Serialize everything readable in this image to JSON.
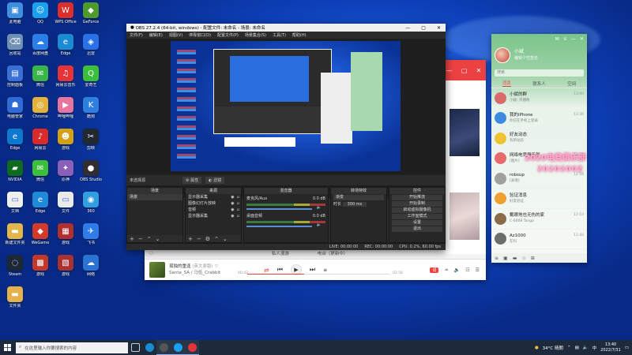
{
  "desktop": {
    "icons": [
      {
        "label": "此电脑",
        "color": "#3f8fe0",
        "glyph": "▣"
      },
      {
        "label": "QQ",
        "color": "#1aa0f0",
        "glyph": "☺"
      },
      {
        "label": "WPS Office",
        "color": "#d9302f",
        "glyph": "W"
      },
      {
        "label": "GeForce",
        "color": "#4e9a2c",
        "glyph": "◆"
      },
      {
        "label": "回收站",
        "color": "#6f8fb5",
        "glyph": "⌫"
      },
      {
        "label": "百度网盘",
        "color": "#2a7fe6",
        "glyph": "☁"
      },
      {
        "label": "Edge",
        "color": "#1a8ad2",
        "glyph": "e"
      },
      {
        "label": "迅雷",
        "color": "#2a70e6",
        "glyph": "◈"
      },
      {
        "label": "控制面板",
        "color": "#3a6fd6",
        "glyph": "▤"
      },
      {
        "label": "微信",
        "color": "#39b54a",
        "glyph": "✉"
      },
      {
        "label": "网易云音乐",
        "color": "#e5333a",
        "glyph": "♫"
      },
      {
        "label": "爱奇艺",
        "color": "#3cbf3a",
        "glyph": "Q"
      },
      {
        "label": "电脑管家",
        "color": "#2f6ad6",
        "glyph": "☗"
      },
      {
        "label": "Chrome",
        "color": "#e2b33a",
        "glyph": "◎"
      },
      {
        "label": "哔哩哔哩",
        "color": "#e874a0",
        "glyph": "▶"
      },
      {
        "label": "酷狗",
        "color": "#2d7fe0",
        "glyph": "K"
      },
      {
        "label": "Edge",
        "color": "#0c79cf",
        "glyph": "e"
      },
      {
        "label": "网易云",
        "color": "#d82b2b",
        "glyph": "♪"
      },
      {
        "label": "游戏",
        "color": "#d4a017",
        "glyph": "☻"
      },
      {
        "label": "剪映",
        "color": "#222831",
        "glyph": "✂"
      },
      {
        "label": "NVIDIA",
        "color": "#0f6b1f",
        "glyph": "▰"
      },
      {
        "label": "微信",
        "color": "#3cbf3a",
        "glyph": "✉"
      },
      {
        "label": "原神",
        "color": "#8a5fb8",
        "glyph": "✦"
      },
      {
        "label": "OBS Studio",
        "color": "#302e31",
        "glyph": "●"
      },
      {
        "label": "文档",
        "color": "#f0f0f0",
        "glyph": "▭"
      },
      {
        "label": "Edge",
        "color": "#1f8ad8",
        "glyph": "e"
      },
      {
        "label": "文件",
        "color": "#eaeaea",
        "glyph": "▭"
      },
      {
        "label": "360",
        "color": "#2f9fe0",
        "glyph": "◉"
      },
      {
        "label": "新建文件夹",
        "color": "#e1b64a",
        "glyph": "▬"
      },
      {
        "label": "WeGame",
        "color": "#d23a2a",
        "glyph": "◆"
      },
      {
        "label": "游戏",
        "color": "#b03030",
        "glyph": "▦"
      },
      {
        "label": "飞书",
        "color": "#2f7be8",
        "glyph": "✈"
      },
      {
        "label": "Steam",
        "color": "#1b2838",
        "glyph": "◌"
      },
      {
        "label": "游戏",
        "color": "#c0392b",
        "glyph": "▩"
      },
      {
        "label": "游戏",
        "color": "#a83232",
        "glyph": "▧"
      },
      {
        "label": "网络",
        "color": "#2a73d1",
        "glyph": "☁"
      },
      {
        "label": "文件夹",
        "color": "#e3b24d",
        "glyph": "▬"
      }
    ]
  },
  "obs": {
    "title": "OBS 27.2.4 (64-bit, windows) - 配置文件: 未命名 - 场景: 未命名",
    "menu": [
      "文件(F)",
      "编辑(E)",
      "视图(V)",
      "停靠窗口(D)",
      "配置文件(P)",
      "场景集合(S)",
      "工具(T)",
      "帮助(H)"
    ],
    "source_bar": {
      "label": "未选择源",
      "props": "属性",
      "filters": "滤镜"
    },
    "docks": {
      "scenes": {
        "title": "场景",
        "items": [
          "场景"
        ]
      },
      "sources": {
        "title": "来源",
        "items": [
          "显示器采集",
          "图像幻灯片放映",
          "音频",
          "显示器采集"
        ]
      },
      "mixer": {
        "title": "混音器",
        "tracks": [
          {
            "name": "麦克风/Aux",
            "db": "0.0 dB"
          },
          {
            "name": "桌面音频",
            "db": "0.0 dB"
          }
        ]
      },
      "transitions": {
        "title": "转场特效",
        "type": "渐变",
        "duration_label": "时长",
        "duration": "300 ms"
      },
      "controls": {
        "title": "控件",
        "buttons": [
          "开始推流",
          "开始录制",
          "启动虚拟摄像机",
          "工作室模式",
          "设置",
          "退出"
        ]
      }
    },
    "status": {
      "live": "LIVE: 00:00:00",
      "rec": "REC: 00:00:00",
      "cpu": "CPU: 0.2%, 60.00 fps"
    }
  },
  "music": {
    "tabs": [
      "私人漫游",
      "电台（更新中）"
    ],
    "song": "孤独的重逢",
    "song_tag": "(英文原版)",
    "artist": "Santa_SA / 马伍_Crabbit",
    "time_elapsed": "00:42",
    "time_total": "02:56",
    "lyric_label": "词",
    "accent": "#ec4141"
  },
  "qq": {
    "username": "小斌",
    "signature": "编辑个性签名",
    "search_placeholder": "搜索",
    "tabs": [
      "消息",
      "联系人",
      "空间"
    ],
    "chats": [
      {
        "name": "小斌的群",
        "preview": "小斌: 开播啦",
        "time": "13:40",
        "color": "#d96b6b"
      },
      {
        "name": "我的iPhone",
        "preview": "你已在手机上登录",
        "time": "13:36",
        "color": "#3d8be0"
      },
      {
        "name": "好友动态",
        "preview": "有新动态",
        "time": "",
        "color": "#f1c232"
      },
      {
        "name": "网络电竞俱乐部",
        "preview": "[图片]",
        "time": "13:20",
        "color": "#e86a6a"
      },
      {
        "name": "robsup",
        "preview": "[表情]",
        "time": "12:58",
        "color": "#a0a0a0"
      },
      {
        "name": "验证消息",
        "preview": "好友验证",
        "time": "",
        "color": "#f0a030"
      },
      {
        "name": "戴眼地也无伤的家",
        "preview": "C-6008 Tango",
        "time": "12:10",
        "color": "#8c6b4a"
      },
      {
        "name": "Az1000",
        "preview": "在吗",
        "time": "11:44",
        "color": "#6d6d6d"
      }
    ]
  },
  "overlay": {
    "line1": "2020电竞俱乐部",
    "line2": "2020200Z"
  },
  "taskbar": {
    "search_placeholder": "在这里输入你要搜索的内容",
    "weather": "34°C 晴朗",
    "time": "13:40",
    "date": "2022/7/31"
  }
}
